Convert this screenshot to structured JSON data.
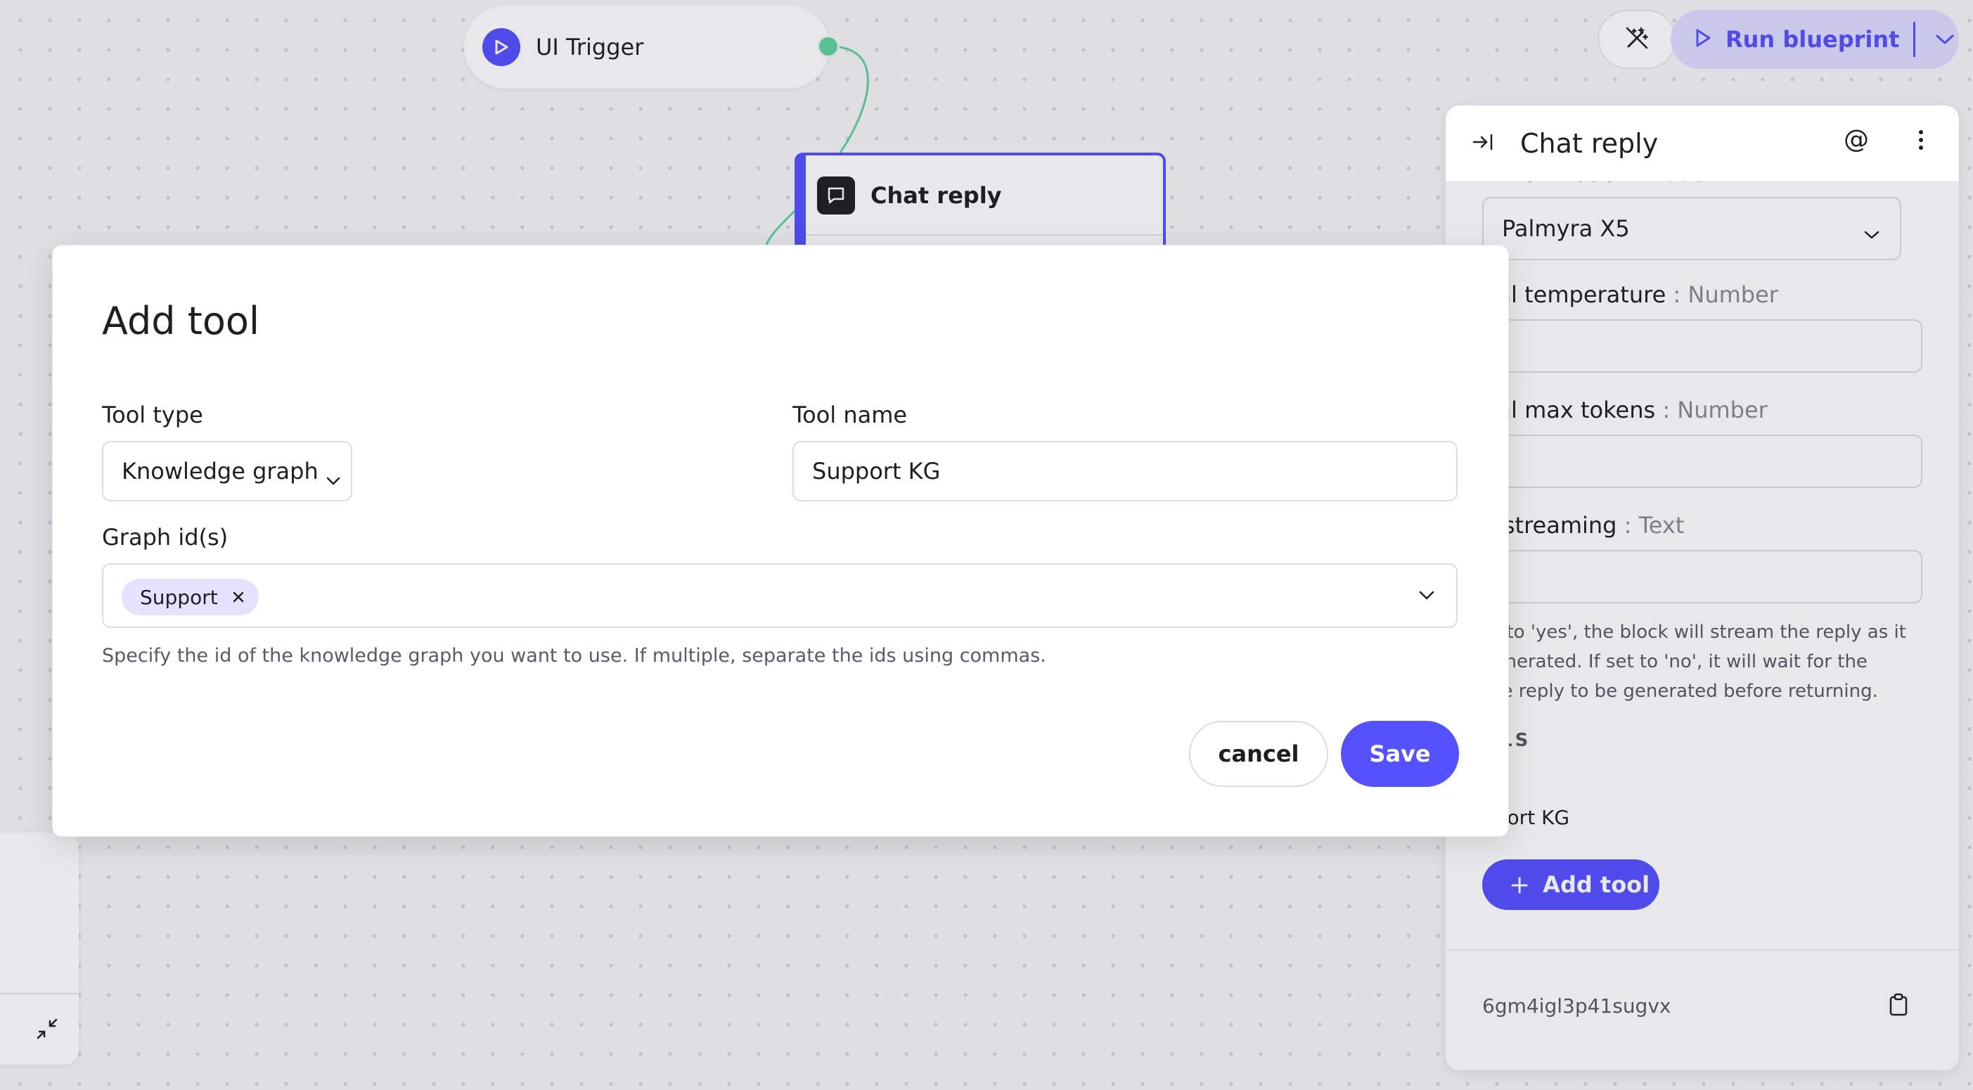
{
  "canvas": {
    "trigger_node": {
      "label": "UI Trigger",
      "icon": "play-icon"
    },
    "chat_node": {
      "title": "Chat reply",
      "icon": "chat-bubble-icon"
    }
  },
  "toolbar": {
    "magic_icon": "magic-wand-icon",
    "run_label": "Run blueprint",
    "run_icon": "play-icon",
    "run_menu_icon": "chevron-down-icon"
  },
  "panel": {
    "title": "Chat reply",
    "collapse_icon": "collapse-right-icon",
    "at_symbol": "@",
    "more_icon": "more-vertical-icon",
    "cut_label": "Initial model",
    "cut_label_type": ": Model",
    "model_value": "Palmyra X5",
    "fields": [
      {
        "label": "tial temperature",
        "type": ": Number"
      },
      {
        "label": "tial max tokens",
        "type": ": Number"
      },
      {
        "label": "e streaming",
        "type": ": Text"
      }
    ],
    "help_lines": [
      "et to 'yes', the block will stream the reply as it",
      "generated. If set to 'no', it will wait for the",
      "tire reply to be generated before returning."
    ],
    "section_label": "OLS",
    "tool_item": "pport KG",
    "add_tool_label": "Add tool",
    "block_id": "6gm4igl3p41sugvx",
    "copy_icon": "clipboard-icon"
  },
  "zoom": {
    "collapse_icon": "minimize-arrows-icon"
  },
  "dialog": {
    "title": "Add tool",
    "tool_type_label": "Tool type",
    "tool_type_value": "Knowledge graph",
    "tool_name_label": "Tool name",
    "tool_name_value": "Support KG",
    "graph_ids_label": "Graph id(s)",
    "graph_chips": [
      "Support"
    ],
    "graph_help": "Specify the id of the knowledge graph you want to use. If multiple, separate the ids using commas.",
    "cancel_label": "cancel",
    "save_label": "Save"
  },
  "colors": {
    "accent": "#5551ff",
    "accent_soft": "#dedcff",
    "port": "#5fd39a"
  }
}
